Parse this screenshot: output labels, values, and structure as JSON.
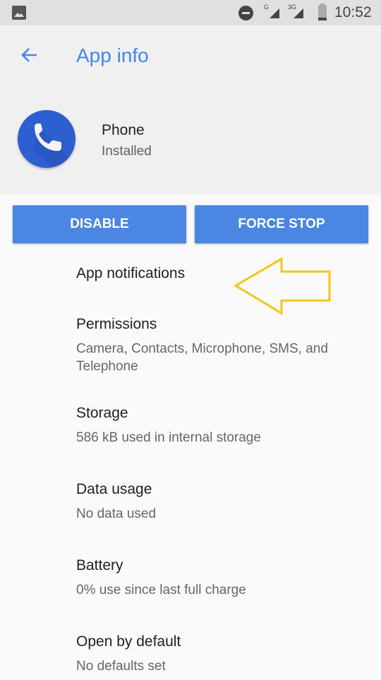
{
  "status_bar": {
    "icons": [
      "gallery-icon",
      "do-not-disturb-icon",
      "signal-g-icon",
      "signal-3g-icon",
      "battery-icon"
    ],
    "signal_1_label": "G",
    "signal_2_label": "3G",
    "time": "10:52"
  },
  "header": {
    "back_icon": "arrow-back-icon",
    "title": "App info"
  },
  "app": {
    "icon": "phone-icon",
    "name": "Phone",
    "status": "Installed"
  },
  "buttons": {
    "disable": "DISABLE",
    "force_stop": "FORCE STOP"
  },
  "colors": {
    "accent": "#4285f4",
    "button": "#4a86e2",
    "annotation_arrow": "#f5c518"
  },
  "items": [
    {
      "title": "App notifications",
      "summary": ""
    },
    {
      "title": "Permissions",
      "summary": "Camera, Contacts, Microphone, SMS, and Telephone"
    },
    {
      "title": "Storage",
      "summary": "586 kB used in internal storage"
    },
    {
      "title": "Data usage",
      "summary": "No data used"
    },
    {
      "title": "Battery",
      "summary": "0% use since last full charge"
    },
    {
      "title": "Open by default",
      "summary": "No defaults set"
    }
  ]
}
